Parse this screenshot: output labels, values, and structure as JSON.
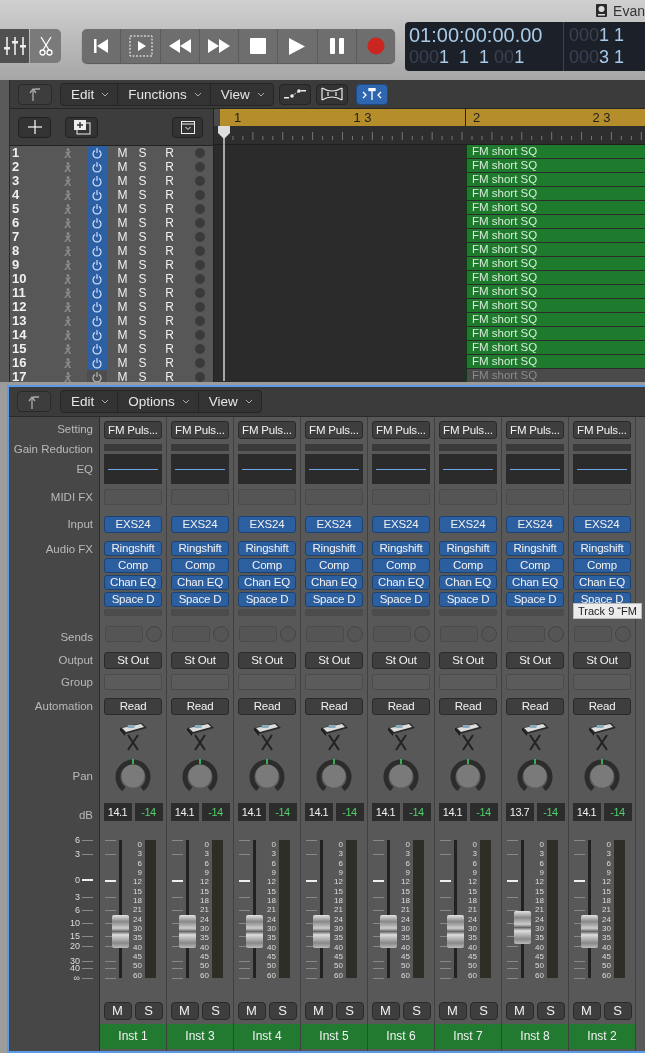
{
  "window": {
    "user": "Evan"
  },
  "view_buttons": [
    {
      "selected": true
    },
    {
      "selected": false
    }
  ],
  "lcd": {
    "left": [
      [
        {
          "text": "01:00:00:00.00",
          "dim": false
        }
      ],
      [
        {
          "text": "000",
          "dim": true
        },
        {
          "text": "1 1 1",
          "dim": false
        },
        {
          "text": "00",
          "dim": true
        },
        {
          "text": "1",
          "dim": false
        }
      ]
    ],
    "right": [
      [
        {
          "text": "000",
          "dim": true
        },
        {
          "text": "1",
          "dim": false
        },
        {
          "text": "1",
          "dim": false
        }
      ],
      [
        {
          "text": "000",
          "dim": true
        },
        {
          "text": "3",
          "dim": false
        },
        {
          "text": "1",
          "dim": false
        }
      ]
    ]
  },
  "tracks": {
    "menus": [
      "Edit",
      "Functions",
      "View"
    ],
    "catch": {
      "selected": true
    },
    "ruler": [
      "1",
      "1 3",
      "2",
      "2 3"
    ],
    "rows": [
      {
        "number": "1",
        "on": true,
        "mute": "M",
        "solo": "S",
        "record": "R",
        "region": "FM short SQ"
      },
      {
        "number": "2",
        "on": true,
        "mute": "M",
        "solo": "S",
        "record": "R",
        "region": "FM short SQ"
      },
      {
        "number": "3",
        "on": true,
        "mute": "M",
        "solo": "S",
        "record": "R",
        "region": "FM short SQ"
      },
      {
        "number": "4",
        "on": true,
        "mute": "M",
        "solo": "S",
        "record": "R",
        "region": "FM short SQ"
      },
      {
        "number": "5",
        "on": true,
        "mute": "M",
        "solo": "S",
        "record": "R",
        "region": "FM short SQ"
      },
      {
        "number": "6",
        "on": true,
        "mute": "M",
        "solo": "S",
        "record": "R",
        "region": "FM short SQ"
      },
      {
        "number": "7",
        "on": true,
        "mute": "M",
        "solo": "S",
        "record": "R",
        "region": "FM short SQ"
      },
      {
        "number": "8",
        "on": true,
        "mute": "M",
        "solo": "S",
        "record": "R",
        "region": "FM short SQ"
      },
      {
        "number": "9",
        "on": true,
        "mute": "M",
        "solo": "S",
        "record": "R",
        "region": "FM short SQ"
      },
      {
        "number": "10",
        "on": true,
        "mute": "M",
        "solo": "S",
        "record": "R",
        "region": "FM short SQ"
      },
      {
        "number": "11",
        "on": true,
        "mute": "M",
        "solo": "S",
        "record": "R",
        "region": "FM short SQ"
      },
      {
        "number": "12",
        "on": true,
        "mute": "M",
        "solo": "S",
        "record": "R",
        "region": "FM short SQ"
      },
      {
        "number": "13",
        "on": true,
        "mute": "M",
        "solo": "S",
        "record": "R",
        "region": "FM short SQ"
      },
      {
        "number": "14",
        "on": true,
        "mute": "M",
        "solo": "S",
        "record": "R",
        "region": "FM short SQ"
      },
      {
        "number": "15",
        "on": true,
        "mute": "M",
        "solo": "S",
        "record": "R",
        "region": "FM short SQ"
      },
      {
        "number": "16",
        "on": true,
        "mute": "M",
        "solo": "S",
        "record": "R",
        "region": "FM short SQ"
      },
      {
        "number": "17",
        "on": false,
        "mute": "M",
        "solo": "S",
        "record": "R",
        "region": "FM short SQ"
      }
    ]
  },
  "mixer": {
    "menus": [
      "Edit",
      "Options",
      "View"
    ],
    "labels": [
      "Setting",
      "Gain Reduction",
      "EQ",
      "MIDI FX",
      "Input",
      "Audio FX",
      "Sends",
      "Output",
      "Group",
      "Automation",
      "Pan",
      "dB"
    ],
    "fader_scale": [
      "6",
      "3",
      "0",
      "3",
      "6",
      "10",
      "15",
      "20",
      "30",
      "40",
      "∞"
    ],
    "tooltip": "Track 9 “FM",
    "strips": [
      {
        "setting": "FM Puls...",
        "input": "EXS24",
        "audio_fx": [
          "Ringshift",
          "Comp",
          "Chan EQ",
          "Space D"
        ],
        "output": "St Out",
        "automation": "Read",
        "volume": "14.1",
        "peak": "-14",
        "level": 0.29,
        "meter_scale": [
          "0",
          "3",
          "6",
          "9",
          "12",
          "15",
          "18",
          "21",
          "24",
          "30",
          "35",
          "40",
          "45",
          "50",
          "60"
        ],
        "mute": "M",
        "solo": "S",
        "name": "Inst 1"
      },
      {
        "setting": "FM Puls...",
        "input": "EXS24",
        "audio_fx": [
          "Ringshift",
          "Comp",
          "Chan EQ",
          "Space D"
        ],
        "output": "St Out",
        "automation": "Read",
        "volume": "14.1",
        "peak": "-14",
        "level": 0.29,
        "meter_scale": [
          "0",
          "3",
          "6",
          "9",
          "12",
          "15",
          "18",
          "21",
          "24",
          "30",
          "35",
          "40",
          "45",
          "50",
          "60"
        ],
        "mute": "M",
        "solo": "S",
        "name": "Inst 3"
      },
      {
        "setting": "FM Puls...",
        "input": "EXS24",
        "audio_fx": [
          "Ringshift",
          "Comp",
          "Chan EQ",
          "Space D"
        ],
        "output": "St Out",
        "automation": "Read",
        "volume": "14.1",
        "peak": "-14",
        "level": 0.29,
        "meter_scale": [
          "0",
          "3",
          "6",
          "9",
          "12",
          "15",
          "18",
          "21",
          "24",
          "30",
          "35",
          "40",
          "45",
          "50",
          "60"
        ],
        "mute": "M",
        "solo": "S",
        "name": "Inst 4"
      },
      {
        "setting": "FM Puls...",
        "input": "EXS24",
        "audio_fx": [
          "Ringshift",
          "Comp",
          "Chan EQ",
          "Space D"
        ],
        "output": "St Out",
        "automation": "Read",
        "volume": "14.1",
        "peak": "-14",
        "level": 0.29,
        "meter_scale": [
          "0",
          "3",
          "6",
          "9",
          "12",
          "15",
          "18",
          "21",
          "24",
          "30",
          "35",
          "40",
          "45",
          "50",
          "60"
        ],
        "mute": "M",
        "solo": "S",
        "name": "Inst 5"
      },
      {
        "setting": "FM Puls...",
        "input": "EXS24",
        "audio_fx": [
          "Ringshift",
          "Comp",
          "Chan EQ",
          "Space D"
        ],
        "output": "St Out",
        "automation": "Read",
        "volume": "14.1",
        "peak": "-14",
        "level": 0.29,
        "meter_scale": [
          "0",
          "3",
          "6",
          "9",
          "12",
          "15",
          "18",
          "21",
          "24",
          "30",
          "35",
          "40",
          "45",
          "50",
          "60"
        ],
        "mute": "M",
        "solo": "S",
        "name": "Inst 6"
      },
      {
        "setting": "FM Puls...",
        "input": "EXS24",
        "audio_fx": [
          "Ringshift",
          "Comp",
          "Chan EQ",
          "Space D"
        ],
        "output": "St Out",
        "automation": "Read",
        "volume": "14.1",
        "peak": "-14",
        "level": 0.29,
        "meter_scale": [
          "0",
          "3",
          "6",
          "9",
          "12",
          "15",
          "18",
          "21",
          "24",
          "30",
          "35",
          "40",
          "45",
          "50",
          "60"
        ],
        "mute": "M",
        "solo": "S",
        "name": "Inst 7"
      },
      {
        "setting": "FM Puls...",
        "input": "EXS24",
        "audio_fx": [
          "Ringshift",
          "Comp",
          "Chan EQ",
          "Space D"
        ],
        "output": "St Out",
        "automation": "Read",
        "volume": "13.7",
        "peak": "-14",
        "level": 0.32,
        "meter_scale": [
          "0",
          "3",
          "6",
          "9",
          "12",
          "15",
          "18",
          "21",
          "24",
          "30",
          "35",
          "40",
          "45",
          "50",
          "60"
        ],
        "mute": "M",
        "solo": "S",
        "name": "Inst 8"
      },
      {
        "setting": "FM Puls...",
        "input": "EXS24",
        "audio_fx": [
          "Ringshift",
          "Comp",
          "Chan EQ",
          "Space D"
        ],
        "output": "St Out",
        "automation": "Read",
        "volume": "14.1",
        "peak": "-14",
        "level": 0.29,
        "meter_scale": [
          "0",
          "3",
          "6",
          "9",
          "12",
          "15",
          "18",
          "21",
          "24",
          "30",
          "35",
          "40",
          "45",
          "50",
          "60"
        ],
        "mute": "M",
        "solo": "S",
        "name": "Inst 2"
      }
    ]
  }
}
